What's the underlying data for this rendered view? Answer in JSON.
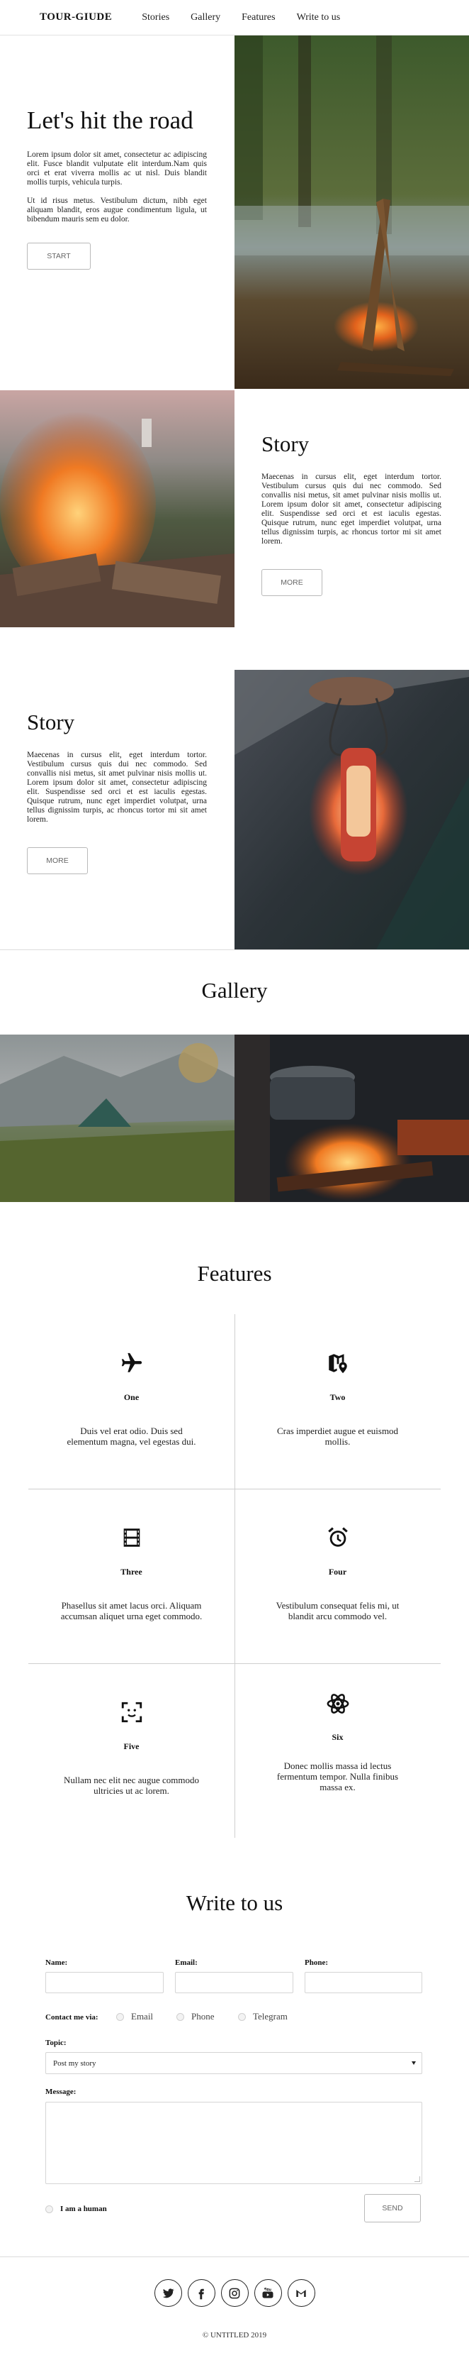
{
  "nav": {
    "logo": "TOUR-GIUDE",
    "links": [
      "Stories",
      "Gallery",
      "Features",
      "Write to us"
    ]
  },
  "hero": {
    "title": "Let's hit the road",
    "p1": "Lorem ipsum dolor sit amet, consectetur ac adipiscing elit. Fusce blandit vulputate elit interdum.Nam quis orci et erat viverra mollis ac ut nisl. Duis blandit mollis turpis, vehicula turpis.",
    "p2": "Ut id risus metus. Vestibulum dictum, nibh eget aliquam blandit, eros augue condimentum ligula, ut bibendum mauris sem eu dolor.",
    "button": "START",
    "image_icon": "campfire-photo"
  },
  "story1": {
    "title": "Story",
    "text": "Maecenas in cursus elit, eget interdum tortor. Vestibulum cursus quis dui nec commodo. Sed convallis nisi metus, sit amet pulvinar nisis mollis ut. Lorem ipsum dolor sit amet, consectetur adipiscing elit. Suspendisse sed orci et est iaculis egestas. Quisque rutrum, nunc eget imperdiet volutpat, urna tellus dignissim turpis, ac rhoncus tortor mi sit amet lorem.",
    "button": "MORE",
    "image_icon": "bonfire-photo"
  },
  "story2": {
    "title": "Story",
    "text": "Maecenas in cursus elit, eget interdum tortor. Vestibulum cursus quis dui nec commodo. Sed convallis nisi metus, sit amet pulvinar nisis mollis ut. Lorem ipsum dolor sit amet, consectetur adipiscing elit. Suspendisse sed orci et est iaculis egestas. Quisque rutrum, nunc eget imperdiet volutpat, urna tellus dignissim turpis, ac rhoncus tortor mi sit amet lorem.",
    "button": "MORE",
    "image_icon": "lantern-photo"
  },
  "gallery": {
    "title": "Gallery",
    "images": [
      "tent-photo",
      "cooking-fire-photo"
    ]
  },
  "features": {
    "title": "Features",
    "items": [
      {
        "name": "One",
        "desc": "Duis vel erat odio. Duis sed elementum magna, vel egestas dui.",
        "icon": "airplane-icon"
      },
      {
        "name": "Two",
        "desc": "Cras imperdiet augue et euismod mollis.",
        "icon": "map-pin-icon"
      },
      {
        "name": "Three",
        "desc": "Phasellus sit amet lacus orci. Aliquam accumsan aliquet urna eget commodo.",
        "icon": "film-icon"
      },
      {
        "name": "Four",
        "desc": "Vestibulum consequat felis mi, ut blandit arcu commodo vel.",
        "icon": "alarm-clock-icon"
      },
      {
        "name": "Five",
        "desc": "Nullam nec elit nec augue commodo ultricies ut ac lorem.",
        "icon": "face-scan-icon"
      },
      {
        "name": "Six",
        "desc": "Donec mollis massa id lectus fermentum tempor. Nulla finibus massa ex.",
        "icon": "atom-icon"
      }
    ]
  },
  "contact": {
    "title": "Write to us",
    "name_label": "Name:",
    "email_label": "Email:",
    "phone_label": "Phone:",
    "contact_via_label": "Contact me via:",
    "contact_options": [
      "Email",
      "Phone",
      "Telegram"
    ],
    "topic_label": "Topic:",
    "topic_selected": "Post my story",
    "message_label": "Message:",
    "human_label": "I am a human",
    "send_button": "SEND"
  },
  "footer": {
    "socials": [
      "twitter-icon",
      "facebook-icon",
      "instagram-icon",
      "youtube-icon",
      "gmail-icon"
    ],
    "copyright": "© UNTITLED 2019"
  }
}
